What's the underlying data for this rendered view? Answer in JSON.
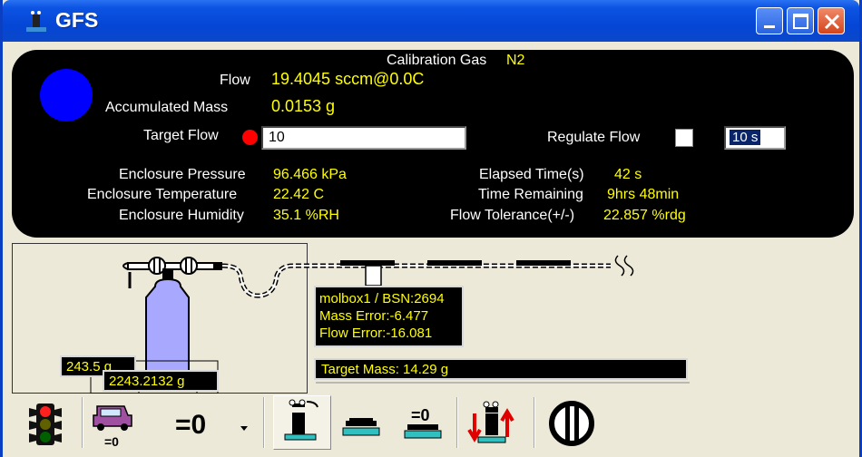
{
  "window": {
    "title": "GFS"
  },
  "panel": {
    "calibration_gas_label": "Calibration Gas",
    "calibration_gas_value": "N2",
    "flow_label": "Flow",
    "flow_value": "19.4045 sccm@0.0C",
    "accumulated_mass_label": "Accumulated Mass",
    "accumulated_mass_value": "0.0153 g",
    "target_flow_label": "Target Flow",
    "target_flow_value": "10",
    "regulate_flow_label": "Regulate Flow",
    "regulate_interval_value": "10 s",
    "enclosure_pressure_label": "Enclosure Pressure",
    "enclosure_pressure_value": "96.466 kPa",
    "enclosure_temperature_label": "Enclosure Temperature",
    "enclosure_temperature_value": "22.42 C",
    "enclosure_humidity_label": "Enclosure Humidity",
    "enclosure_humidity_value": "35.1 %RH",
    "elapsed_time_label": "Elapsed Time(s)",
    "elapsed_time_value": "42 s",
    "time_remaining_label": "Time Remaining",
    "time_remaining_value": "9hrs 48min",
    "flow_tolerance_label": "Flow Tolerance(+/-)",
    "flow_tolerance_value": "22.857 %rdg"
  },
  "scene": {
    "cylinder_mass": "243.5 g",
    "scale_mass": "2243.2132 g",
    "molbox_line": "molbox1 / BSN:2694",
    "mass_error": "Mass Error:-6.477",
    "flow_error": "Flow Error:-16.081",
    "target_mass": "Target Mass: 14.29 g"
  },
  "toolbar": {
    "tare_label": "=0",
    "zero_label": "=0"
  },
  "colors": {
    "status_dot": "#0000ff",
    "value_text": "#ffff00",
    "target_flow_indicator": "#ff0000"
  }
}
